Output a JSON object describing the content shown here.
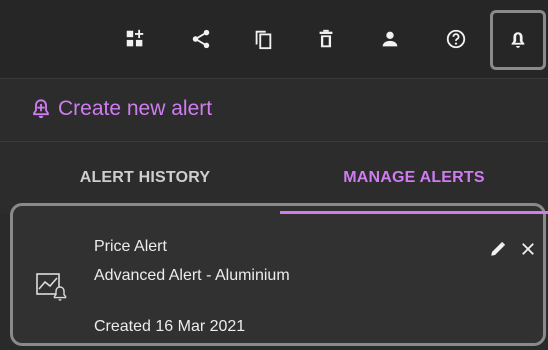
{
  "toolbar": {
    "icons": [
      "add-widget-icon",
      "share-icon",
      "copy-icon",
      "delete-icon",
      "user-icon",
      "help-icon",
      "bell-icon"
    ]
  },
  "create_alert": {
    "label": "Create new alert",
    "icon": "add-alert-bell-icon",
    "color": "#cf7cf0"
  },
  "tabs": [
    {
      "label": "ALERT HISTORY",
      "active": false
    },
    {
      "label": "MANAGE ALERTS",
      "active": true
    }
  ],
  "alert": {
    "type": "Price Alert",
    "description": "Advanced Alert - Aluminium",
    "created": "Created 16 Mar 2021",
    "icon": "chart-alert-icon"
  },
  "colors": {
    "accent": "#cf7cf0",
    "background": "#2a2a2a",
    "highlight_border": "#8a8a8a"
  }
}
